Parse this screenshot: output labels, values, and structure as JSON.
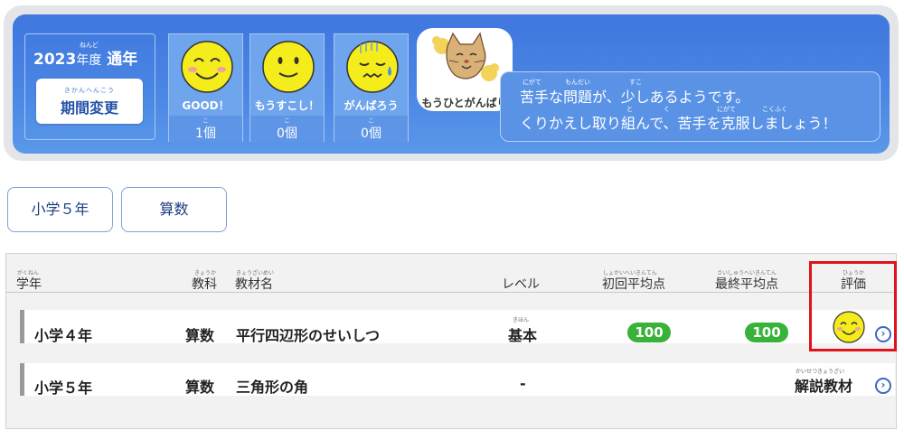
{
  "banner": {
    "year_ruby": "ねんど",
    "year": "2023",
    "year_unit": "年度",
    "year_kind": "通年",
    "period_button": {
      "ruby": "きかんへんこう",
      "label": "期間変更"
    },
    "evaluations": [
      {
        "icon": "smile-face-icon",
        "name": "GOOD！",
        "count_ruby": "こ",
        "count": "1個"
      },
      {
        "icon": "neutral-face-icon",
        "name": "もうすこし！",
        "count_ruby": "こ",
        "count": "0個"
      },
      {
        "icon": "sweat-face-icon",
        "name": "がんばろう",
        "count_ruby": "こ",
        "count": "0個"
      }
    ],
    "character_label": "もうひとがんばり",
    "message": {
      "line1": "苦手な問題が、少しあるようです。",
      "line2": "くりかえし取り組んで、苦手を克服しましょう！",
      "rubies": {
        "nigate1": "にがて",
        "mondai": "もんだい",
        "sukoshi": "すこ",
        "to": "と",
        "ku": "く",
        "nigate2": "にがて",
        "kokufuku": "こくふく"
      }
    }
  },
  "filters": {
    "grade": "小学５年",
    "subject": "算数"
  },
  "table": {
    "headers": {
      "grade": {
        "ruby": "がくねん",
        "label": "学年"
      },
      "subject": {
        "ruby": "きょうか",
        "label": "教科"
      },
      "material": {
        "ruby": "きょうざいめい",
        "label": "教材名"
      },
      "level": {
        "label": "レベル"
      },
      "first_avg": {
        "ruby": "しょかいへいきんてん",
        "label": "初回平均点"
      },
      "final_avg": {
        "ruby": "さいしゅうへいきんてん",
        "label": "最終平均点"
      },
      "rating": {
        "ruby": "ひょうか",
        "label": "評価"
      }
    },
    "rows": [
      {
        "grade": "小学４年",
        "subject": "算数",
        "material": "平行四辺形のせいしつ",
        "level_ruby": "きほん",
        "level": "基本",
        "first_avg": "100",
        "final_avg": "100",
        "rating_icon": "smile-face-icon",
        "rating_text": ""
      },
      {
        "grade": "小学５年",
        "subject": "算数",
        "material": "三角形の角",
        "level_ruby": "",
        "level": "-",
        "first_avg": "",
        "final_avg": "",
        "rating_ruby": "かいせつきょうざい",
        "rating_text": "解説教材"
      }
    ]
  },
  "colors": {
    "banner_blue": "#4a86e4",
    "score_green": "#38b238",
    "highlight_red": "#e0121b",
    "face_yellow": "#f5ec1c"
  }
}
